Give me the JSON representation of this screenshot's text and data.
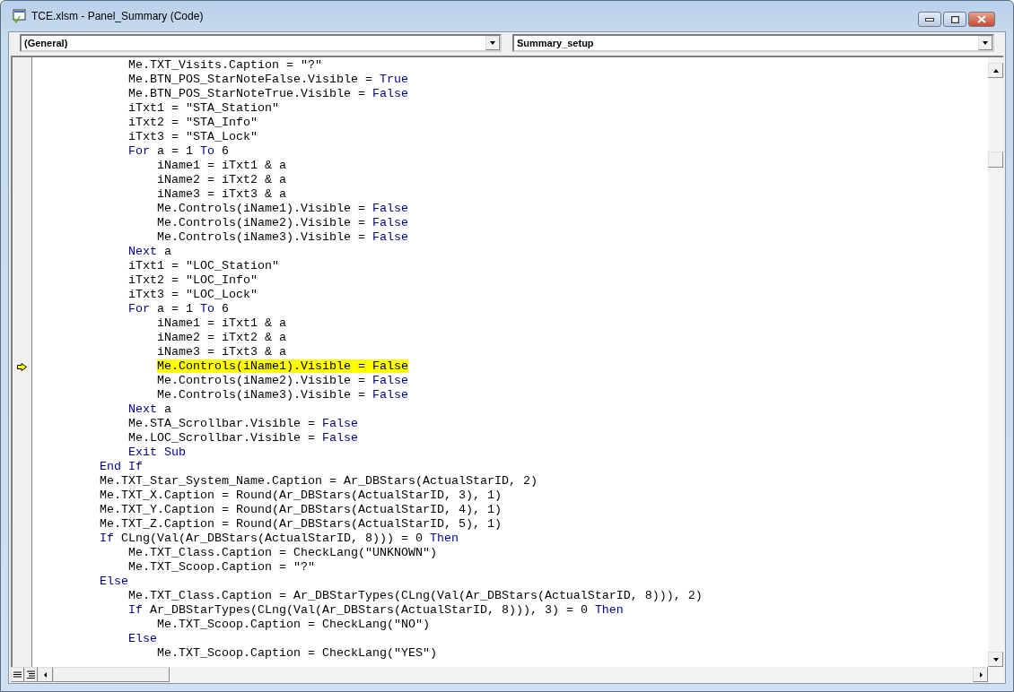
{
  "window": {
    "title": "TCE.xlsm - Panel_Summary (Code)"
  },
  "object_box": {
    "value": "(General)"
  },
  "procedure_box": {
    "value": "Summary_setup"
  },
  "code_lines": [
    {
      "highlighted": false,
      "execution_point": false,
      "tokens": [
        {
          "kind": "plain",
          "text": "            Me.TXT_Visits.Caption = \"?\""
        }
      ]
    },
    {
      "highlighted": false,
      "execution_point": false,
      "tokens": [
        {
          "kind": "plain",
          "text": "            Me.BTN_POS_StarNoteFalse.Visible = "
        },
        {
          "kind": "keyword",
          "text": "True"
        }
      ]
    },
    {
      "highlighted": false,
      "execution_point": false,
      "tokens": [
        {
          "kind": "plain",
          "text": "            Me.BTN_POS_StarNoteTrue.Visible = "
        },
        {
          "kind": "keyword",
          "text": "False"
        }
      ]
    },
    {
      "highlighted": false,
      "execution_point": false,
      "tokens": [
        {
          "kind": "plain",
          "text": "            iTxt1 = \"STA_Station\""
        }
      ]
    },
    {
      "highlighted": false,
      "execution_point": false,
      "tokens": [
        {
          "kind": "plain",
          "text": "            iTxt2 = \"STA_Info\""
        }
      ]
    },
    {
      "highlighted": false,
      "execution_point": false,
      "tokens": [
        {
          "kind": "plain",
          "text": "            iTxt3 = \"STA_Lock\""
        }
      ]
    },
    {
      "highlighted": false,
      "execution_point": false,
      "tokens": [
        {
          "kind": "keyword",
          "text": "            For"
        },
        {
          "kind": "plain",
          "text": " a = 1 "
        },
        {
          "kind": "keyword",
          "text": "To"
        },
        {
          "kind": "plain",
          "text": " 6"
        }
      ]
    },
    {
      "highlighted": false,
      "execution_point": false,
      "tokens": [
        {
          "kind": "plain",
          "text": "                iName1 = iTxt1 & a"
        }
      ]
    },
    {
      "highlighted": false,
      "execution_point": false,
      "tokens": [
        {
          "kind": "plain",
          "text": "                iName2 = iTxt2 & a"
        }
      ]
    },
    {
      "highlighted": false,
      "execution_point": false,
      "tokens": [
        {
          "kind": "plain",
          "text": "                iName3 = iTxt3 & a"
        }
      ]
    },
    {
      "highlighted": false,
      "execution_point": false,
      "tokens": [
        {
          "kind": "plain",
          "text": "                Me.Controls(iName1).Visible = "
        },
        {
          "kind": "keyword",
          "text": "False"
        }
      ]
    },
    {
      "highlighted": false,
      "execution_point": false,
      "tokens": [
        {
          "kind": "plain",
          "text": "                Me.Controls(iName2).Visible = "
        },
        {
          "kind": "keyword",
          "text": "False"
        }
      ]
    },
    {
      "highlighted": false,
      "execution_point": false,
      "tokens": [
        {
          "kind": "plain",
          "text": "                Me.Controls(iName3).Visible = "
        },
        {
          "kind": "keyword",
          "text": "False"
        }
      ]
    },
    {
      "highlighted": false,
      "execution_point": false,
      "tokens": [
        {
          "kind": "keyword",
          "text": "            Next"
        },
        {
          "kind": "plain",
          "text": " a"
        }
      ]
    },
    {
      "highlighted": false,
      "execution_point": false,
      "tokens": [
        {
          "kind": "plain",
          "text": "            iTxt1 = \"LOC_Station\""
        }
      ]
    },
    {
      "highlighted": false,
      "execution_point": false,
      "tokens": [
        {
          "kind": "plain",
          "text": "            iTxt2 = \"LOC_Info\""
        }
      ]
    },
    {
      "highlighted": false,
      "execution_point": false,
      "tokens": [
        {
          "kind": "plain",
          "text": "            iTxt3 = \"LOC_Lock\""
        }
      ]
    },
    {
      "highlighted": false,
      "execution_point": false,
      "tokens": [
        {
          "kind": "keyword",
          "text": "            For"
        },
        {
          "kind": "plain",
          "text": " a = 1 "
        },
        {
          "kind": "keyword",
          "text": "To"
        },
        {
          "kind": "plain",
          "text": " 6"
        }
      ]
    },
    {
      "highlighted": false,
      "execution_point": false,
      "tokens": [
        {
          "kind": "plain",
          "text": "                iName1 = iTxt1 & a"
        }
      ]
    },
    {
      "highlighted": false,
      "execution_point": false,
      "tokens": [
        {
          "kind": "plain",
          "text": "                iName2 = iTxt2 & a"
        }
      ]
    },
    {
      "highlighted": false,
      "execution_point": false,
      "tokens": [
        {
          "kind": "plain",
          "text": "                iName3 = iTxt3 & a"
        }
      ]
    },
    {
      "highlighted": true,
      "execution_point": true,
      "tokens": [
        {
          "kind": "plain",
          "text": "                Me.Controls(iName1).Visible = False"
        }
      ]
    },
    {
      "highlighted": false,
      "execution_point": false,
      "tokens": [
        {
          "kind": "plain",
          "text": "                Me.Controls(iName2).Visible = "
        },
        {
          "kind": "keyword",
          "text": "False"
        }
      ]
    },
    {
      "highlighted": false,
      "execution_point": false,
      "tokens": [
        {
          "kind": "plain",
          "text": "                Me.Controls(iName3).Visible = "
        },
        {
          "kind": "keyword",
          "text": "False"
        }
      ]
    },
    {
      "highlighted": false,
      "execution_point": false,
      "tokens": [
        {
          "kind": "keyword",
          "text": "            Next"
        },
        {
          "kind": "plain",
          "text": " a"
        }
      ]
    },
    {
      "highlighted": false,
      "execution_point": false,
      "tokens": [
        {
          "kind": "plain",
          "text": "            Me.STA_Scrollbar.Visible = "
        },
        {
          "kind": "keyword",
          "text": "False"
        }
      ]
    },
    {
      "highlighted": false,
      "execution_point": false,
      "tokens": [
        {
          "kind": "plain",
          "text": "            Me.LOC_Scrollbar.Visible = "
        },
        {
          "kind": "keyword",
          "text": "False"
        }
      ]
    },
    {
      "highlighted": false,
      "execution_point": false,
      "tokens": [
        {
          "kind": "keyword",
          "text": "            Exit Sub"
        }
      ]
    },
    {
      "highlighted": false,
      "execution_point": false,
      "tokens": [
        {
          "kind": "keyword",
          "text": "        End If"
        }
      ]
    },
    {
      "highlighted": false,
      "execution_point": false,
      "tokens": [
        {
          "kind": "plain",
          "text": "        Me.TXT_Star_System_Name.Caption = Ar_DBStars(ActualStarID, 2)"
        }
      ]
    },
    {
      "highlighted": false,
      "execution_point": false,
      "tokens": [
        {
          "kind": "plain",
          "text": "        Me.TXT_X.Caption = Round(Ar_DBStars(ActualStarID, 3), 1)"
        }
      ]
    },
    {
      "highlighted": false,
      "execution_point": false,
      "tokens": [
        {
          "kind": "plain",
          "text": "        Me.TXT_Y.Caption = Round(Ar_DBStars(ActualStarID, 4), 1)"
        }
      ]
    },
    {
      "highlighted": false,
      "execution_point": false,
      "tokens": [
        {
          "kind": "plain",
          "text": "        Me.TXT_Z.Caption = Round(Ar_DBStars(ActualStarID, 5), 1)"
        }
      ]
    },
    {
      "highlighted": false,
      "execution_point": false,
      "tokens": [
        {
          "kind": "keyword",
          "text": "        If"
        },
        {
          "kind": "plain",
          "text": " CLng(Val(Ar_DBStars(ActualStarID, 8))) = 0 "
        },
        {
          "kind": "keyword",
          "text": "Then"
        }
      ]
    },
    {
      "highlighted": false,
      "execution_point": false,
      "tokens": [
        {
          "kind": "plain",
          "text": "            Me.TXT_Class.Caption = CheckLang(\"UNKNOWN\")"
        }
      ]
    },
    {
      "highlighted": false,
      "execution_point": false,
      "tokens": [
        {
          "kind": "plain",
          "text": "            Me.TXT_Scoop.Caption = \"?\""
        }
      ]
    },
    {
      "highlighted": false,
      "execution_point": false,
      "tokens": [
        {
          "kind": "keyword",
          "text": "        Else"
        }
      ]
    },
    {
      "highlighted": false,
      "execution_point": false,
      "tokens": [
        {
          "kind": "plain",
          "text": "            Me.TXT_Class.Caption = Ar_DBStarTypes(CLng(Val(Ar_DBStars(ActualStarID, 8))), 2)"
        }
      ]
    },
    {
      "highlighted": false,
      "execution_point": false,
      "tokens": [
        {
          "kind": "keyword",
          "text": "            If"
        },
        {
          "kind": "plain",
          "text": " Ar_DBStarTypes(CLng(Val(Ar_DBStars(ActualStarID, 8))), 3) = 0 "
        },
        {
          "kind": "keyword",
          "text": "Then"
        }
      ]
    },
    {
      "highlighted": false,
      "execution_point": false,
      "tokens": [
        {
          "kind": "plain",
          "text": "                Me.TXT_Scoop.Caption = CheckLang(\"NO\")"
        }
      ]
    },
    {
      "highlighted": false,
      "execution_point": false,
      "tokens": [
        {
          "kind": "keyword",
          "text": "            Else"
        }
      ]
    },
    {
      "highlighted": false,
      "execution_point": false,
      "tokens": [
        {
          "kind": "plain",
          "text": "                Me.TXT_Scoop.Caption = CheckLang(\"YES\")"
        }
      ]
    }
  ]
}
